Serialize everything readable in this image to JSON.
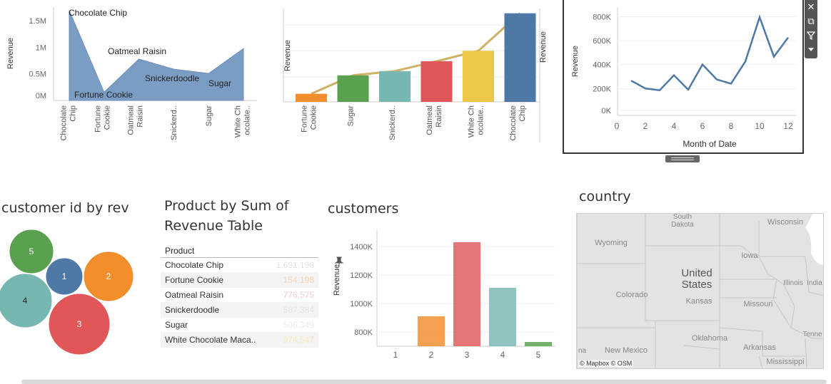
{
  "chart_data": [
    {
      "type": "area",
      "x": [
        "Chocolate Chip",
        "Fortune Cookie",
        "Oatmeal Raisin",
        "Snickerdoodle",
        "Sugar",
        "White Chocolate Macadamia Nut"
      ],
      "values": [
        1691198,
        154198,
        776575,
        587384,
        506349,
        974547
      ],
      "x_tick_labels": [
        [
          "Chocolate",
          "Chip"
        ],
        [
          "Fortune",
          "Cookie"
        ],
        [
          "Oatmeal",
          "Raisin"
        ],
        [
          "Snickerd.."
        ],
        [
          "Sugar"
        ],
        [
          "White Ch",
          "ocolate.."
        ]
      ],
      "mark_labels": [
        "Chocolate Chip",
        "Fortune Cookie",
        "Oatmeal Raisin",
        "Snickerdoodle",
        "Sugar",
        ""
      ],
      "ylabel": "Revenue",
      "y_ticks": [
        "0M",
        "0.5M",
        "1M",
        "1.5M"
      ],
      "ylim": [
        0,
        1700000
      ],
      "color": "#7b9cc3"
    },
    {
      "type": "bar",
      "categories": [
        "Fortune Cookie",
        "Sugar",
        "Snickerdoodle",
        "Oatmeal Raisin",
        "White Chocolate Macadamia Nut",
        "Chocolate Chip"
      ],
      "values": [
        154198,
        506349,
        587384,
        776575,
        974547,
        1691198
      ],
      "x_tick_labels": [
        [
          "Fortune",
          "Cookie"
        ],
        [
          "Sugar"
        ],
        [
          "Snickerd.."
        ],
        [
          "Oatmeal",
          "Raisin"
        ],
        [
          "White Ch",
          "ocolate.."
        ],
        [
          "Chocolate",
          "Chip"
        ]
      ],
      "colors": [
        "#f28e2b",
        "#59a14f",
        "#76b7b2",
        "#e15759",
        "#edc948",
        "#4e79a7"
      ],
      "ylabel_left": "Revenue",
      "ylabel_right": "Revenue",
      "ylim": [
        0,
        1700000
      ]
    },
    {
      "type": "line",
      "x": [
        1,
        2,
        3,
        4,
        5,
        6,
        7,
        8,
        9,
        10,
        11,
        12
      ],
      "values": [
        290000,
        225000,
        210000,
        335000,
        215000,
        425000,
        300000,
        265000,
        450000,
        820000,
        490000,
        650000
      ],
      "xlabel": "Month of Date",
      "ylabel": "Revenue",
      "x_ticks": [
        0,
        2,
        4,
        6,
        8,
        10,
        12
      ],
      "y_ticks": [
        "0K",
        "200K",
        "400K",
        "600K",
        "800K"
      ],
      "xlim": [
        0,
        12.5
      ],
      "ylim": [
        0,
        880000
      ],
      "color": "#4e79a7"
    },
    {
      "type": "bubble",
      "title": "customer id by rev",
      "labels": [
        "1",
        "2",
        "3",
        "4",
        "5"
      ],
      "colors": [
        "#4e79a7",
        "#f28e2b",
        "#e15759",
        "#76b7b2",
        "#59a14f"
      ]
    },
    {
      "type": "table",
      "title": "Product by Sum of Revenue Table",
      "columns": [
        "Product"
      ],
      "rows": [
        {
          "product": "Chocolate Chip",
          "value": "1,691,198"
        },
        {
          "product": "Fortune Cookie",
          "value": "154,198"
        },
        {
          "product": "Oatmeal Raisin",
          "value": "776,575"
        },
        {
          "product": "Snickerdoodle",
          "value": "587,384"
        },
        {
          "product": "Sugar",
          "value": "506,349"
        },
        {
          "product": "White Chocolate Maca..",
          "value": "974,547"
        }
      ],
      "value_colors": [
        "#e3e3e3",
        "#f6d3b4",
        "#f4cbcb",
        "#dde6e6",
        "#ececec",
        "#f6e9b8"
      ]
    },
    {
      "type": "bar",
      "title": "customers",
      "categories": [
        "1",
        "2",
        "3",
        "4",
        "5"
      ],
      "values": [
        660000,
        910000,
        1430000,
        1110000,
        730000
      ],
      "colors": [
        "#4e79a7",
        "#f28e2b",
        "#e15759",
        "#76b7b2",
        "#59a14f"
      ],
      "ylabel": "Revenue",
      "y_ticks": [
        "800K",
        "1000K",
        "1200K",
        "1400K"
      ],
      "ylim": [
        700000,
        1500000
      ]
    }
  ],
  "map": {
    "title": "country",
    "labels": [
      {
        "text": "South\nDakota"
      },
      {
        "text": "Wisconsin"
      },
      {
        "text": "Wyoming"
      },
      {
        "text": "Iowa"
      },
      {
        "text": "United\nStates"
      },
      {
        "text": "Illinois"
      },
      {
        "text": "India"
      },
      {
        "text": "Colorado"
      },
      {
        "text": "Kansas"
      },
      {
        "text": "Missouri"
      },
      {
        "text": "Tenne"
      },
      {
        "text": "Oklahoma"
      },
      {
        "text": "Arkansas"
      },
      {
        "text": "New Mexico"
      },
      {
        "text": "na"
      },
      {
        "text": "Mississippi"
      }
    ],
    "attribution": "© Mapbox © OSM"
  },
  "toolbar": {
    "icons": [
      "close-icon",
      "popout-icon",
      "filter-icon",
      "more-options-icon"
    ]
  }
}
